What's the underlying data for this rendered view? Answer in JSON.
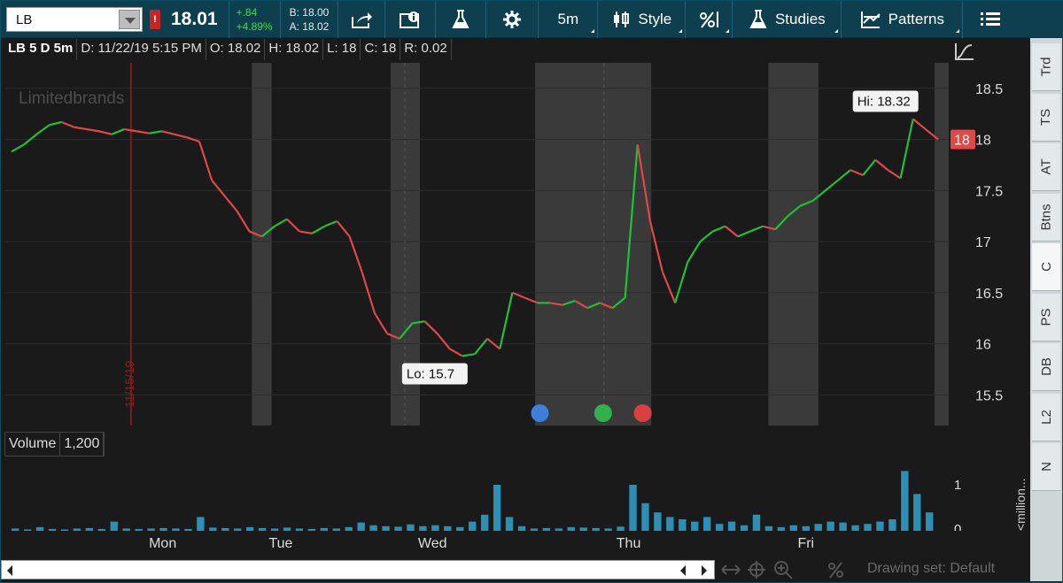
{
  "toolbar": {
    "symbol": "LB",
    "alert_badge": "!",
    "last_price": "18.01",
    "change": "+.84",
    "change_pct": "+4.89%",
    "bid": "B: 18.00",
    "ask": "A: 18.02",
    "aggregation": "5m",
    "style_label": "Style",
    "studies_label": "Studies",
    "patterns_label": "Patterns"
  },
  "chart_header": {
    "title": "LB 5 D 5m",
    "date": "D: 11/22/19 5:15 PM",
    "open": "O: 18.02",
    "high": "H: 18.02",
    "low": "L: 18",
    "close": "C: 18",
    "range": "R: 0.02"
  },
  "watermark": "Limitedbrands",
  "vertical_date_label": "11/15/19",
  "hi_label": "Hi: 18.32",
  "lo_label": "Lo: 15.7",
  "current_price_tag": "18",
  "volume": {
    "label": "Volume",
    "value": "1,200",
    "axis_unit": "<million..."
  },
  "sidebar_tabs": [
    "Trd",
    "TS",
    "AT",
    "Btns",
    "C",
    "PS",
    "DB",
    "L2",
    "N"
  ],
  "active_tab": "C",
  "drawing_set": "Drawing set: Default",
  "colors": {
    "up": "#1fc136",
    "down": "#e04848",
    "toolbar": "#0d3f4f",
    "volume": "#2f8fb3"
  },
  "chart_data": {
    "type": "line",
    "ylim": [
      15.2,
      18.75
    ],
    "yticks": [
      "18.5",
      "18",
      "17.5",
      "17",
      "16.5",
      "16",
      "15.5"
    ],
    "ytick_values": [
      18.5,
      18,
      17.5,
      17,
      16.5,
      16,
      15.5
    ],
    "xticks": [
      "Mon",
      "Tue",
      "Wed",
      "Thu",
      "Fri"
    ],
    "series": [
      {
        "values": [
          17.88,
          17.95,
          18.05,
          18.14,
          18.17,
          18.12,
          18.1,
          18.08,
          18.05,
          18.1,
          18.08,
          18.06,
          18.08,
          18.05,
          18.02,
          17.98,
          17.6,
          17.45,
          17.3,
          17.1,
          17.05,
          17.15,
          17.22,
          17.1,
          17.08,
          17.15,
          17.2,
          17.05,
          16.7,
          16.3,
          16.1,
          16.05,
          16.2,
          16.22,
          16.1,
          15.95,
          15.88,
          15.9,
          16.05,
          15.95,
          16.5,
          16.45,
          16.4,
          16.4,
          16.38,
          16.42,
          16.35,
          16.4,
          16.35,
          16.45,
          17.95,
          17.2,
          16.7,
          16.4,
          16.8,
          17.0,
          17.1,
          17.15,
          17.05,
          17.1,
          17.15,
          17.12,
          17.25,
          17.35,
          17.4,
          17.5,
          17.6,
          17.7,
          17.65,
          17.8,
          17.7,
          17.62,
          18.2,
          18.1,
          18.0
        ]
      }
    ],
    "volume_values": [
      0.05,
      0.03,
      0.08,
      0.04,
      0.03,
      0.05,
      0.06,
      0.04,
      0.2,
      0.05,
      0.04,
      0.05,
      0.06,
      0.05,
      0.04,
      0.3,
      0.07,
      0.06,
      0.05,
      0.08,
      0.06,
      0.05,
      0.07,
      0.05,
      0.04,
      0.06,
      0.05,
      0.08,
      0.18,
      0.12,
      0.1,
      0.09,
      0.14,
      0.1,
      0.12,
      0.1,
      0.08,
      0.2,
      0.35,
      1.0,
      0.3,
      0.1,
      0.05,
      0.06,
      0.05,
      0.08,
      0.07,
      0.06,
      0.05,
      0.09,
      1.0,
      0.6,
      0.4,
      0.3,
      0.25,
      0.2,
      0.3,
      0.15,
      0.2,
      0.12,
      0.35,
      0.1,
      0.08,
      0.12,
      0.1,
      0.15,
      0.2,
      0.18,
      0.12,
      0.15,
      0.2,
      0.25,
      1.3,
      0.8,
      0.4
    ],
    "volume_yticks": [
      "1",
      "0"
    ]
  }
}
